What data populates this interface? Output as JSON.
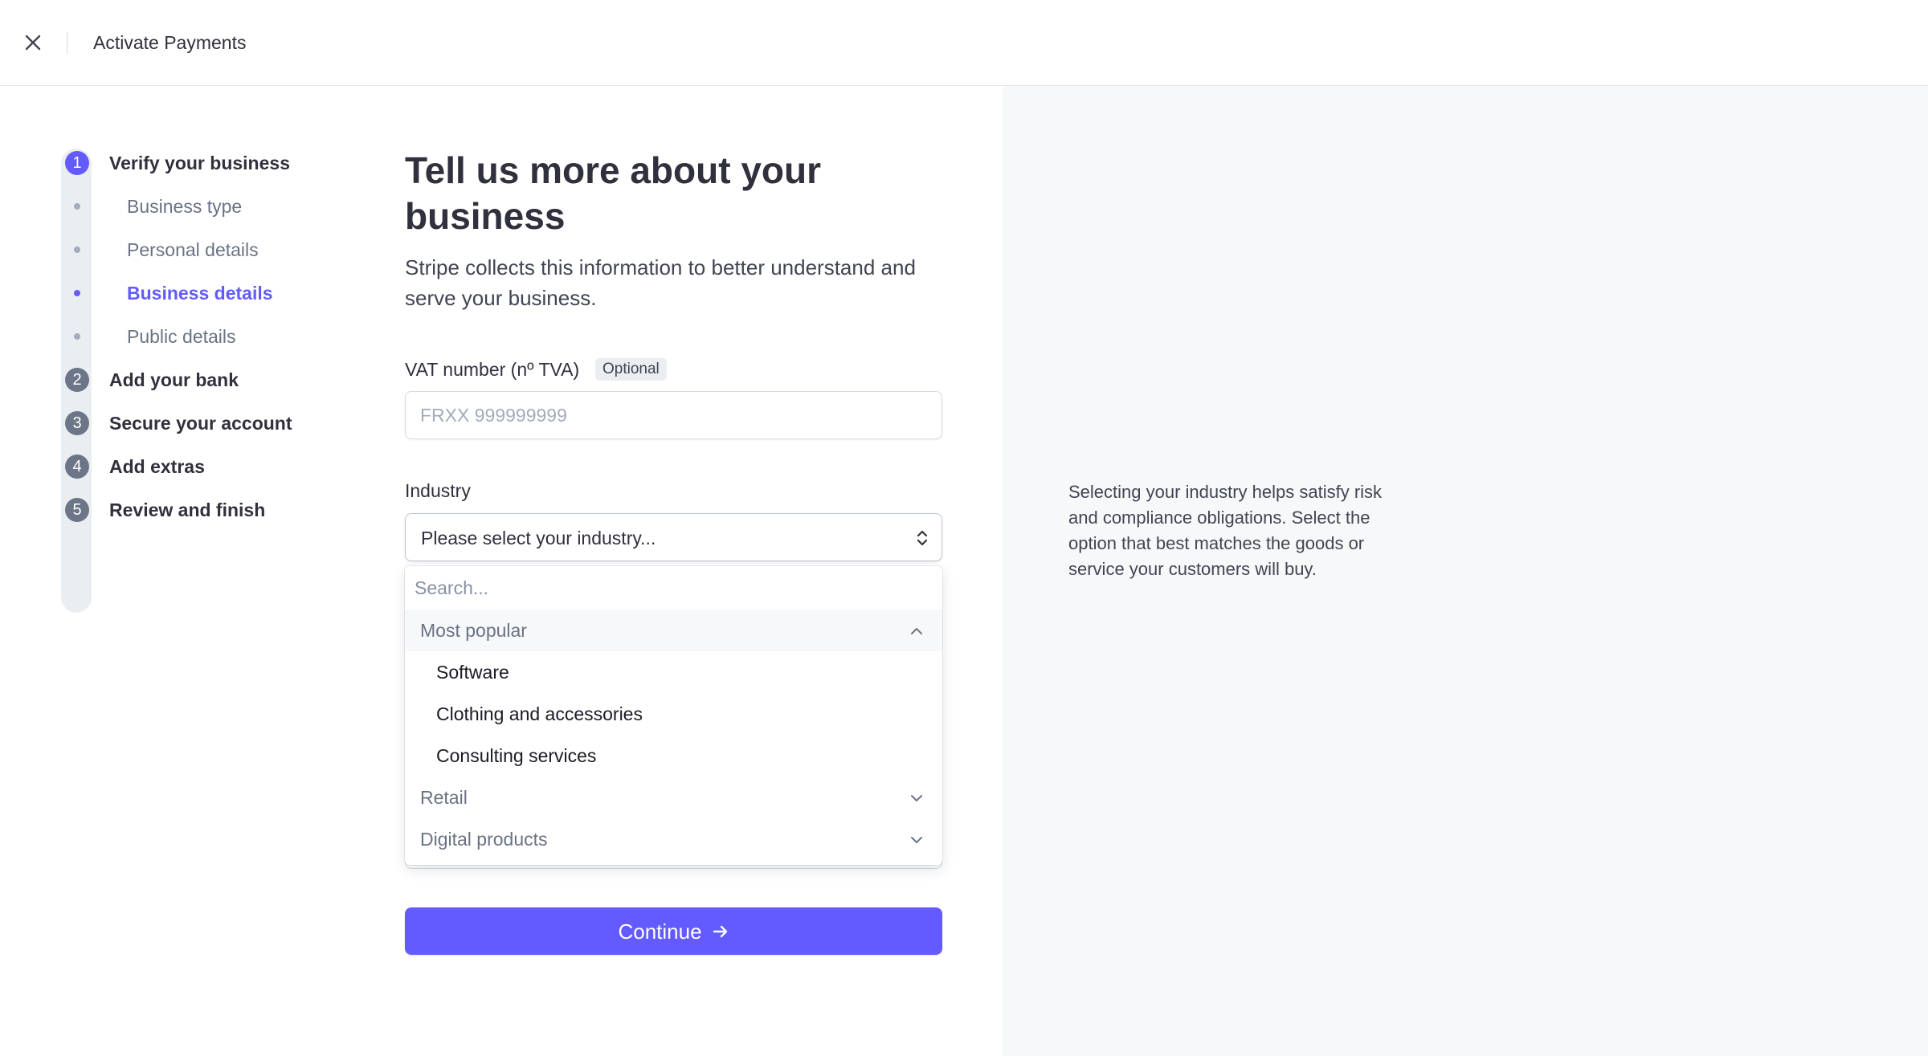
{
  "header": {
    "title": "Activate Payments"
  },
  "stepper": {
    "steps": [
      {
        "number": "1",
        "label": "Verify your business"
      },
      {
        "number": "2",
        "label": "Add your bank"
      },
      {
        "number": "3",
        "label": "Secure your account"
      },
      {
        "number": "4",
        "label": "Add extras"
      },
      {
        "number": "5",
        "label": "Review and finish"
      }
    ],
    "substeps": [
      {
        "label": "Business type"
      },
      {
        "label": "Personal details"
      },
      {
        "label": "Business details",
        "active": true
      },
      {
        "label": "Public details"
      }
    ]
  },
  "main": {
    "title": "Tell us more about your business",
    "description": "Stripe collects this information to better understand and serve your business.",
    "vat": {
      "label": "VAT number (nº TVA)",
      "badge": "Optional",
      "placeholder": "FRXX 999999999",
      "value": ""
    },
    "industry": {
      "label": "Industry",
      "selected": "Please select your industry..."
    },
    "dropdown": {
      "search_placeholder": "Search...",
      "groups": [
        {
          "label": "Most popular",
          "expanded": true,
          "options": [
            "Software",
            "Clothing and accessories",
            "Consulting services"
          ]
        },
        {
          "label": "Retail",
          "expanded": false
        },
        {
          "label": "Digital products",
          "expanded": false
        }
      ]
    },
    "continue_label": "Continue"
  },
  "help": {
    "text": "Selecting your industry helps satisfy risk and compliance obligations. Select the option that best matches the goods or service your customers will buy."
  },
  "colors": {
    "accent": "#635bff",
    "step_inactive": "#6c7688",
    "panel_bg": "#f6f8fa"
  }
}
